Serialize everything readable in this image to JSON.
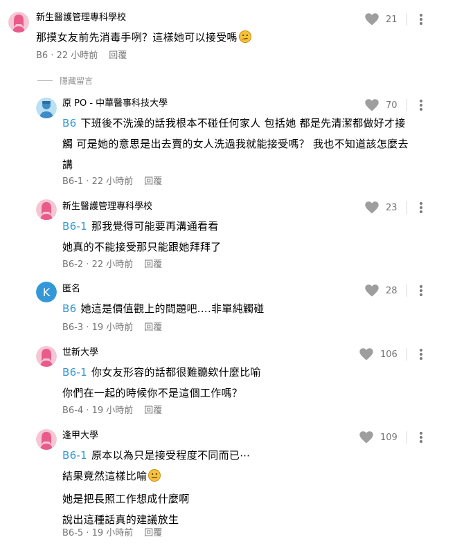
{
  "colors": {
    "floor_link": "#3397cf",
    "avatar_female_bg": "#f5c6d4",
    "avatar_female_fg": "#e85b8b",
    "avatar_op_bg": "#b9e1f3",
    "avatar_op_fg": "#3e8bc6",
    "avatar_anon_bg": "#3498d8",
    "heart": "#9e9e9e"
  },
  "hidden_replies_label": "隱藏留言",
  "reply_label": "回覆",
  "comments": [
    {
      "author": "新生醫護管理專科學校",
      "avatar": "female-avatar-icon",
      "lines": [
        "那摸女友前先消毒手咧？這樣她可以接受嗎"
      ],
      "emoji": "thinking-face-icon",
      "floor": "B6",
      "time": "22 小時前",
      "likes": "21"
    },
    {
      "author": "原 PO - 中華醫事科技大學",
      "avatar": "op-avatar-icon",
      "reply_to": "B6",
      "lines": [
        "下班後不洗澡的話我根本不碰任何家人 包括她  都是先清潔都做好才接",
        "觸  可是她的意思是出去賣的女人洗過我就能接受嗎？  我也不知道該怎麼去",
        "講"
      ],
      "floor": "B6-1",
      "time": "22 小時前",
      "likes": "70"
    },
    {
      "author": "新生醫護管理專科學校",
      "avatar": "female-avatar-icon",
      "reply_to": "B6-1",
      "lines": [
        "那我覺得可能要再溝通看看",
        "她真的不能接受那只能跟她拜拜了"
      ],
      "floor": "B6-2",
      "time": "22 小時前",
      "likes": "23"
    },
    {
      "author": "匿名",
      "avatar": "anonymous-k-avatar",
      "avatar_letter": "K",
      "reply_to": "B6",
      "lines": [
        "她這是價值觀上的問題吧....非單純觸碰"
      ],
      "floor": "B6-3",
      "time": "19 小時前",
      "likes": "28"
    },
    {
      "author": "世新大學",
      "avatar": "female-avatar-icon",
      "reply_to": "B6-1",
      "lines": [
        "你女友形容的話都很難聽欸什麼比喻",
        "你們在一起的時候你不是這個工作嗎？"
      ],
      "floor": "B6-4",
      "time": "19 小時前",
      "likes": "106"
    },
    {
      "author": "逢甲大學",
      "avatar": "female-avatar-icon",
      "reply_to": "B6-1",
      "lines": [
        "原本以為只是接受程度不同而已⋯",
        "結果竟然這樣比喻",
        "她是把長照工作想成什麼啊",
        "說出這種話真的建議放生"
      ],
      "emoji": "neutral-face-icon",
      "floor": "B6-5",
      "time": "19 小時前",
      "likes": "109"
    }
  ]
}
